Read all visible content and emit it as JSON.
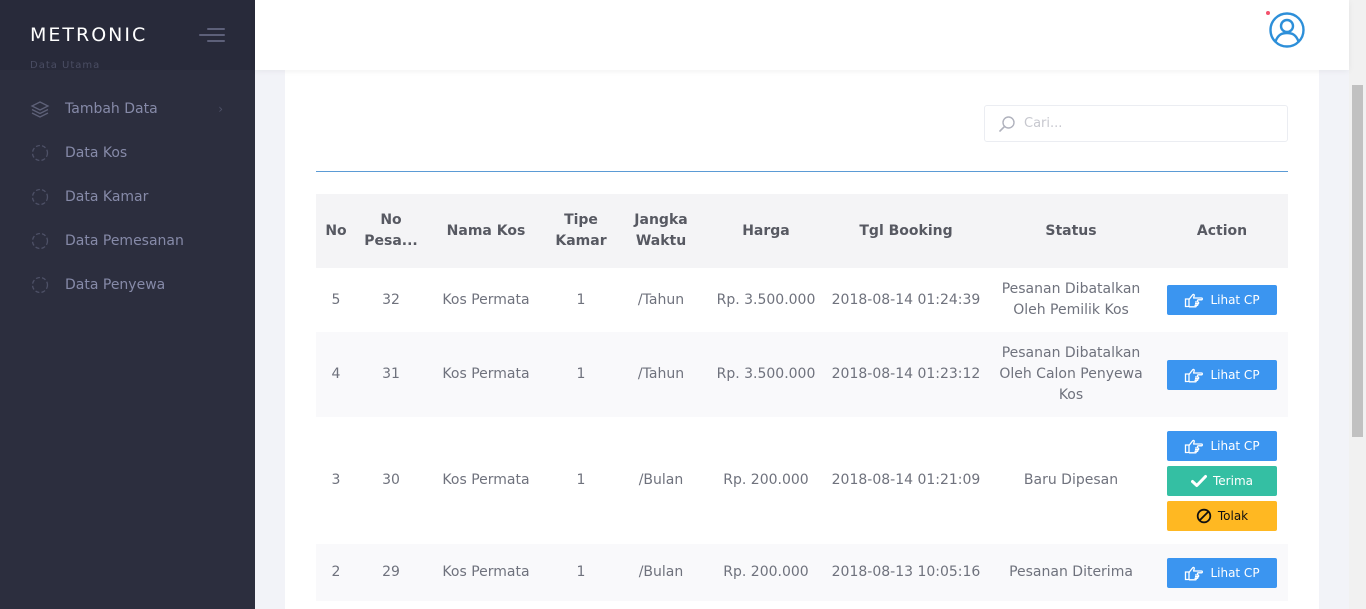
{
  "brand": "METRONIC",
  "sidebar": {
    "section_label": "Data Utama",
    "items": [
      {
        "label": "Tambah Data",
        "icon": "layers-icon",
        "has_arrow": true
      },
      {
        "label": "Data Kos",
        "icon": "circle-dots-icon"
      },
      {
        "label": "Data Kamar",
        "icon": "circle-dots-icon"
      },
      {
        "label": "Data Pemesanan",
        "icon": "circle-dots-icon"
      },
      {
        "label": "Data Penyewa",
        "icon": "circle-dots-icon"
      }
    ],
    "arrow": "›"
  },
  "search": {
    "placeholder": "Cari..."
  },
  "table": {
    "headers": [
      "No",
      "No Pesa...",
      "Nama Kos",
      "Tipe Kamar",
      "Jangka Waktu",
      "Harga",
      "Tgl Booking",
      "Status",
      "Action"
    ],
    "rows": [
      {
        "no": "5",
        "no_pesanan": "32",
        "nama_kos": "Kos Permata",
        "tipe_kamar": "1",
        "jangka_waktu": "/Tahun",
        "harga": "Rp. 3.500.000",
        "tgl_booking": "2018-08-14 01:24:39",
        "status": "Pesanan Dibatalkan Oleh Pemilik Kos",
        "actions": [
          "Lihat CP"
        ]
      },
      {
        "no": "4",
        "no_pesanan": "31",
        "nama_kos": "Kos Permata",
        "tipe_kamar": "1",
        "jangka_waktu": "/Tahun",
        "harga": "Rp. 3.500.000",
        "tgl_booking": "2018-08-14 01:23:12",
        "status": "Pesanan Dibatalkan Oleh Calon Penyewa Kos",
        "actions": [
          "Lihat CP"
        ]
      },
      {
        "no": "3",
        "no_pesanan": "30",
        "nama_kos": "Kos Permata",
        "tipe_kamar": "1",
        "jangka_waktu": "/Bulan",
        "harga": "Rp. 200.000",
        "tgl_booking": "2018-08-14 01:21:09",
        "status": "Baru Dipesan",
        "actions": [
          "Lihat CP",
          "Terima",
          "Tolak"
        ]
      },
      {
        "no": "2",
        "no_pesanan": "29",
        "nama_kos": "Kos Permata",
        "tipe_kamar": "1",
        "jangka_waktu": "/Bulan",
        "harga": "Rp. 200.000",
        "tgl_booking": "2018-08-13 10:05:16",
        "status": "Pesanan Diterima",
        "actions": [
          "Lihat CP"
        ]
      }
    ]
  },
  "colors": {
    "sidebar_bg": "#2c2e3e",
    "accent_blue": "#3b95f0",
    "success_green": "#34bfa3",
    "warning_yellow": "#ffb822",
    "divider_blue": "#5b9bd5"
  },
  "icons": {
    "lihat_cp": "hand-pointing-icon",
    "terima": "check-icon",
    "tolak": "ban-icon",
    "avatar": "user-avatar-icon",
    "search": "search-icon",
    "menu_toggle": "hamburger-icon"
  }
}
